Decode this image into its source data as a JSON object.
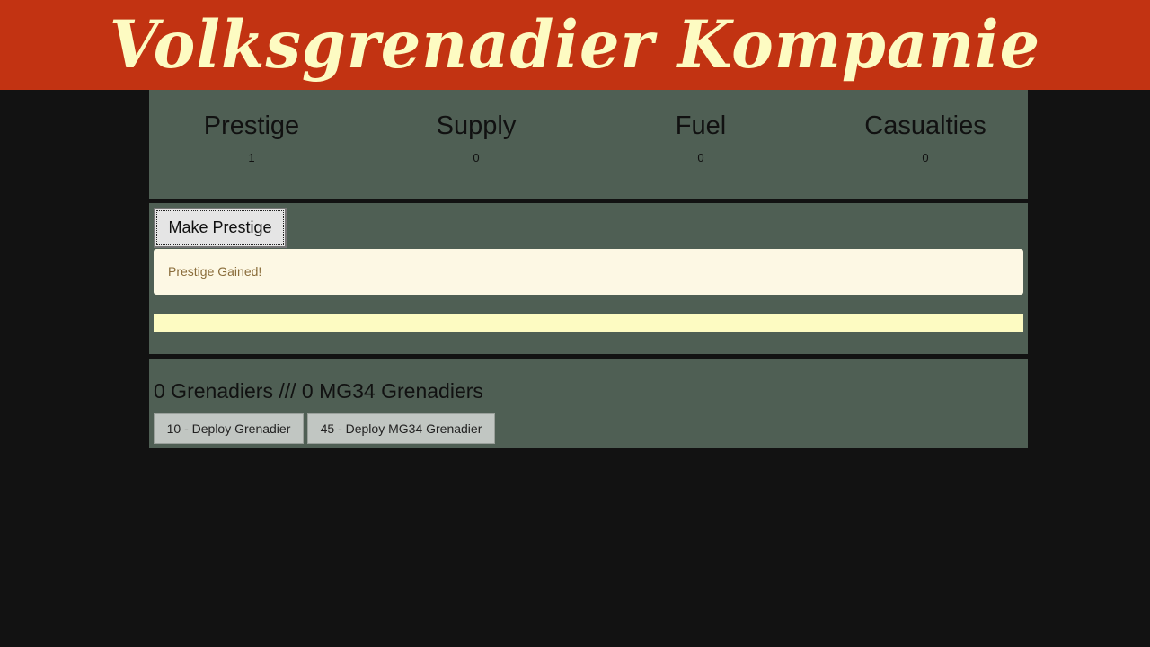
{
  "header": {
    "title": "Volksgrenadier Kompanie",
    "background_color": "#c23312",
    "title_color": "#fdfbc2"
  },
  "stats": [
    {
      "label": "Prestige",
      "value": "1"
    },
    {
      "label": "Supply",
      "value": "0"
    },
    {
      "label": "Fuel",
      "value": "0"
    },
    {
      "label": "Casualties",
      "value": "0"
    }
  ],
  "actions": {
    "make_prestige_label": "Make Prestige",
    "alert_message": "Prestige Gained!",
    "progress_fraction": 1.0
  },
  "units": {
    "grenadier_count": "0",
    "mg34_count": "0",
    "summary": "0 Grenadiers /// 0 MG34 Grenadiers",
    "deploy_grenadier_label": "10 - Deploy Grenadier",
    "deploy_mg34_label": "45 - Deploy MG34 Grenadier"
  },
  "colors": {
    "page_background": "#121212",
    "panel_background": "#4f5f54",
    "alert_background": "#fdf8e4",
    "alert_text": "#8a6d3b",
    "progress_color": "#fdfbc2"
  }
}
